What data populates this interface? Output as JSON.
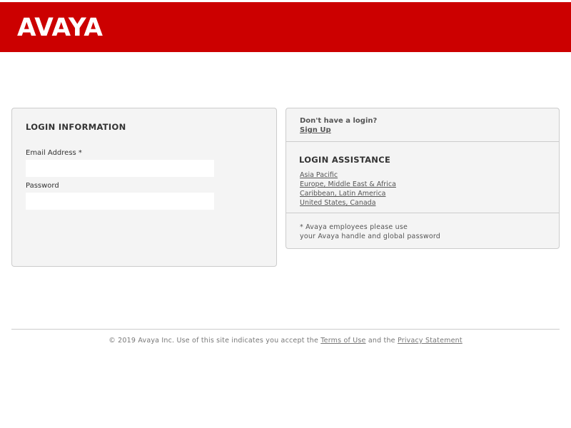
{
  "brand": {
    "logo_text": "AVAYA",
    "header_color": "#cc0000",
    "logo_color": "#ffffff"
  },
  "login": {
    "title": "LOGIN INFORMATION",
    "email_label": "Email Address *",
    "email_value": "",
    "password_label": "Password",
    "password_value": ""
  },
  "signup": {
    "question": "Don't have a login?",
    "link": "Sign Up"
  },
  "assistance": {
    "title": "LOGIN ASSISTANCE",
    "regions": [
      "Asia Pacific",
      "Europe, Middle East & Africa",
      "Caribbean, Latin America",
      "United States, Canada"
    ]
  },
  "note": {
    "line1": "* Avaya employees please use",
    "line2": "your Avaya handle and global password"
  },
  "footer": {
    "prefix": "© 2019 Avaya Inc. Use of this site indicates you accept the",
    "terms_link": "Terms of Use",
    "middle": "and the",
    "privacy_link": "Privacy Statement"
  }
}
